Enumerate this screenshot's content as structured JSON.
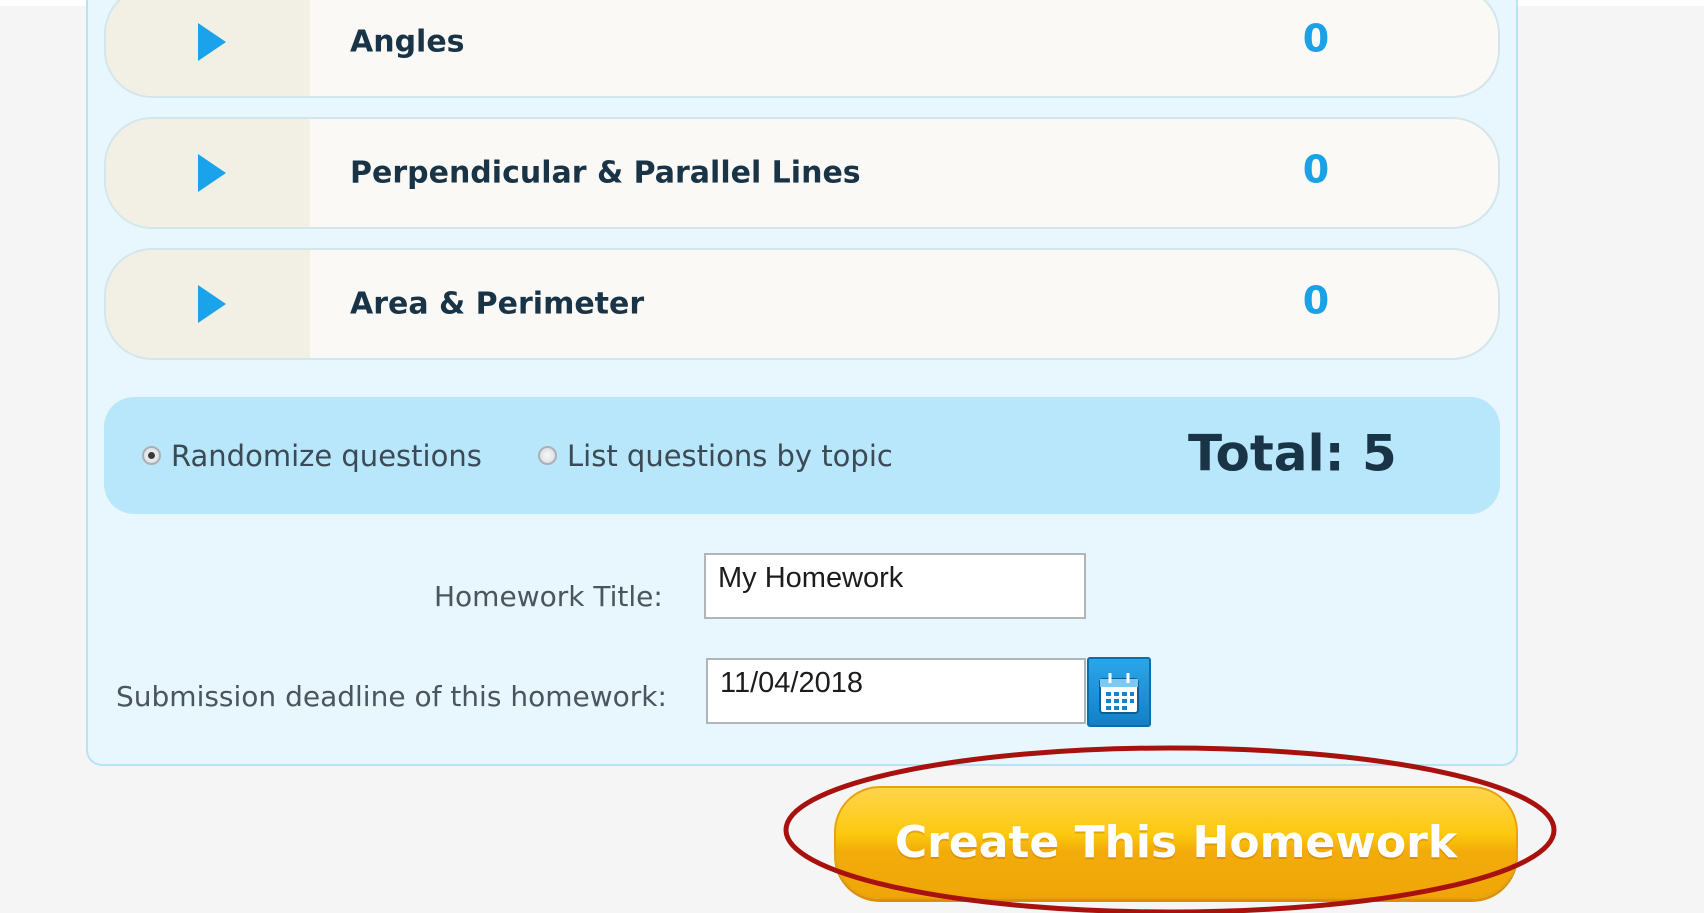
{
  "topics": [
    {
      "name": "Angles",
      "count": "0"
    },
    {
      "name": "Perpendicular & Parallel Lines",
      "count": "0"
    },
    {
      "name": "Area & Perimeter",
      "count": "0"
    }
  ],
  "options": {
    "randomize_label": "Randomize questions",
    "list_by_topic_label": "List questions by topic",
    "selected": "randomize",
    "total_label": "Total: 5"
  },
  "form": {
    "title_label": "Homework Title:",
    "title_value": "My Homework",
    "deadline_label": "Submission deadline of this homework:",
    "deadline_value": "11/04/2018",
    "calendar_icon": "calendar-icon"
  },
  "create_button": {
    "label": "Create This Homework"
  },
  "colors": {
    "accent_blue": "#1ba1e6",
    "button_yellow": "#fcc90f",
    "highlight_red": "#a8120e",
    "panel_bg": "#e8f7fd"
  }
}
